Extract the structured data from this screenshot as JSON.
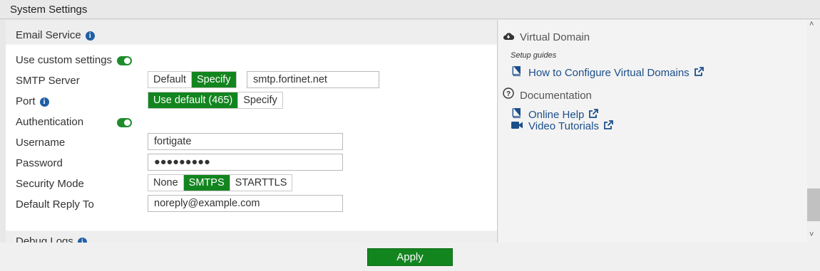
{
  "window": {
    "title": "System Settings"
  },
  "email_service": {
    "header": "Email Service",
    "use_custom_settings_label": "Use custom settings",
    "smtp_server": {
      "label": "SMTP Server",
      "options": [
        "Default",
        "Specify"
      ],
      "selected": "Specify",
      "value": "smtp.fortinet.net"
    },
    "port": {
      "label": "Port",
      "options": [
        "Use default (465)",
        "Specify"
      ],
      "selected": "Use default (465)"
    },
    "authentication_label": "Authentication",
    "username": {
      "label": "Username",
      "value": "fortigate"
    },
    "password": {
      "label": "Password",
      "value": "●●●●●●●●●"
    },
    "security_mode": {
      "label": "Security Mode",
      "options": [
        "None",
        "SMTPS",
        "STARTTLS"
      ],
      "selected": "SMTPS"
    },
    "default_reply_to": {
      "label": "Default Reply To",
      "value": "noreply@example.com"
    }
  },
  "debug_logs": {
    "header": "Debug Logs"
  },
  "sidebar": {
    "virtual_domain": {
      "header": "Virtual Domain",
      "caption": "Setup guides",
      "links": [
        "How to Configure Virtual Domains"
      ]
    },
    "documentation": {
      "header": "Documentation",
      "links": [
        "Online Help",
        "Video Tutorials"
      ]
    }
  },
  "footer": {
    "apply_label": "Apply"
  },
  "colors": {
    "accent": "#13851f",
    "link": "#1c4f8a",
    "info": "#1f5fa6"
  },
  "icons": [
    "info-icon",
    "cloud-icon",
    "book-icon",
    "external-link-icon",
    "help-icon",
    "video-icon",
    "chevron-up-icon",
    "chevron-down-icon"
  ]
}
